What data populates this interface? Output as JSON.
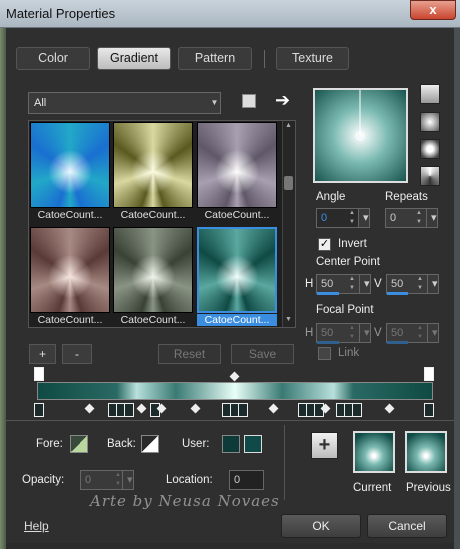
{
  "window": {
    "title": "Material Properties",
    "close_glyph": "x"
  },
  "tabs": [
    {
      "label": "Color",
      "active": false
    },
    {
      "label": "Gradient",
      "active": true
    },
    {
      "label": "Pattern",
      "active": false
    },
    {
      "label": "Texture",
      "active": false
    }
  ],
  "category": {
    "value": "All",
    "arrow_glyph": "▼"
  },
  "icons": {
    "book": "book-icon",
    "arrow_glyph": "➔"
  },
  "gallery": {
    "items": [
      {
        "label": "CatoeCount...",
        "c_center": "#e8f0ff",
        "c_edge": "#1a6fd0",
        "c_mid": "#22a8c8"
      },
      {
        "label": "CatoeCount...",
        "c_center": "#fafad0",
        "c_edge": "#5a5a20",
        "c_mid": "#d8d8a0"
      },
      {
        "label": "CatoeCount...",
        "c_center": "#ffffff",
        "c_edge": "#605868",
        "c_mid": "#a8a0b0"
      },
      {
        "label": "CatoeCount...",
        "c_center": "#f0d8d0",
        "c_edge": "#5a3a36",
        "c_mid": "#a88a84"
      },
      {
        "label": "CatoeCount...",
        "c_center": "#e8f0e0",
        "c_edge": "#3a4236",
        "c_mid": "#8a9484"
      },
      {
        "label": "CatoeCount...",
        "c_center": "#f0fffc",
        "c_edge": "#0f4a44",
        "c_mid": "#5aa8a0",
        "selected": true
      }
    ]
  },
  "gallery_buttons": {
    "add": "+",
    "remove": "-",
    "reset": "Reset",
    "save": "Save"
  },
  "angle": {
    "label": "Angle",
    "value": "0"
  },
  "repeats": {
    "label": "Repeats",
    "value": "0"
  },
  "invert": {
    "label": "Invert",
    "checked": true,
    "check_glyph": "✓"
  },
  "center_point": {
    "label": "Center Point",
    "h_label": "H",
    "h_value": "50",
    "v_label": "V",
    "v_value": "50"
  },
  "focal_point": {
    "label": "Focal Point",
    "h_label": "H",
    "h_value": "50",
    "v_label": "V",
    "v_value": "50"
  },
  "link": {
    "label": "Link",
    "checked": false
  },
  "colors": {
    "fore_label": "Fore:",
    "back_label": "Back:",
    "user_label": "User:",
    "user_swatch_1": "#0f3a3a",
    "user_swatch_2": "#0f4a48",
    "accent": "#3b8de0"
  },
  "opacity": {
    "label": "Opacity:",
    "value": "0"
  },
  "location": {
    "label": "Location:",
    "value": "0"
  },
  "plus_label": "+",
  "current": {
    "label": "Current"
  },
  "previous": {
    "label": "Previous"
  },
  "watermark": "Arte by Neusa Novaes",
  "footer": {
    "help": "Help",
    "ok": "OK",
    "cancel": "Cancel"
  }
}
